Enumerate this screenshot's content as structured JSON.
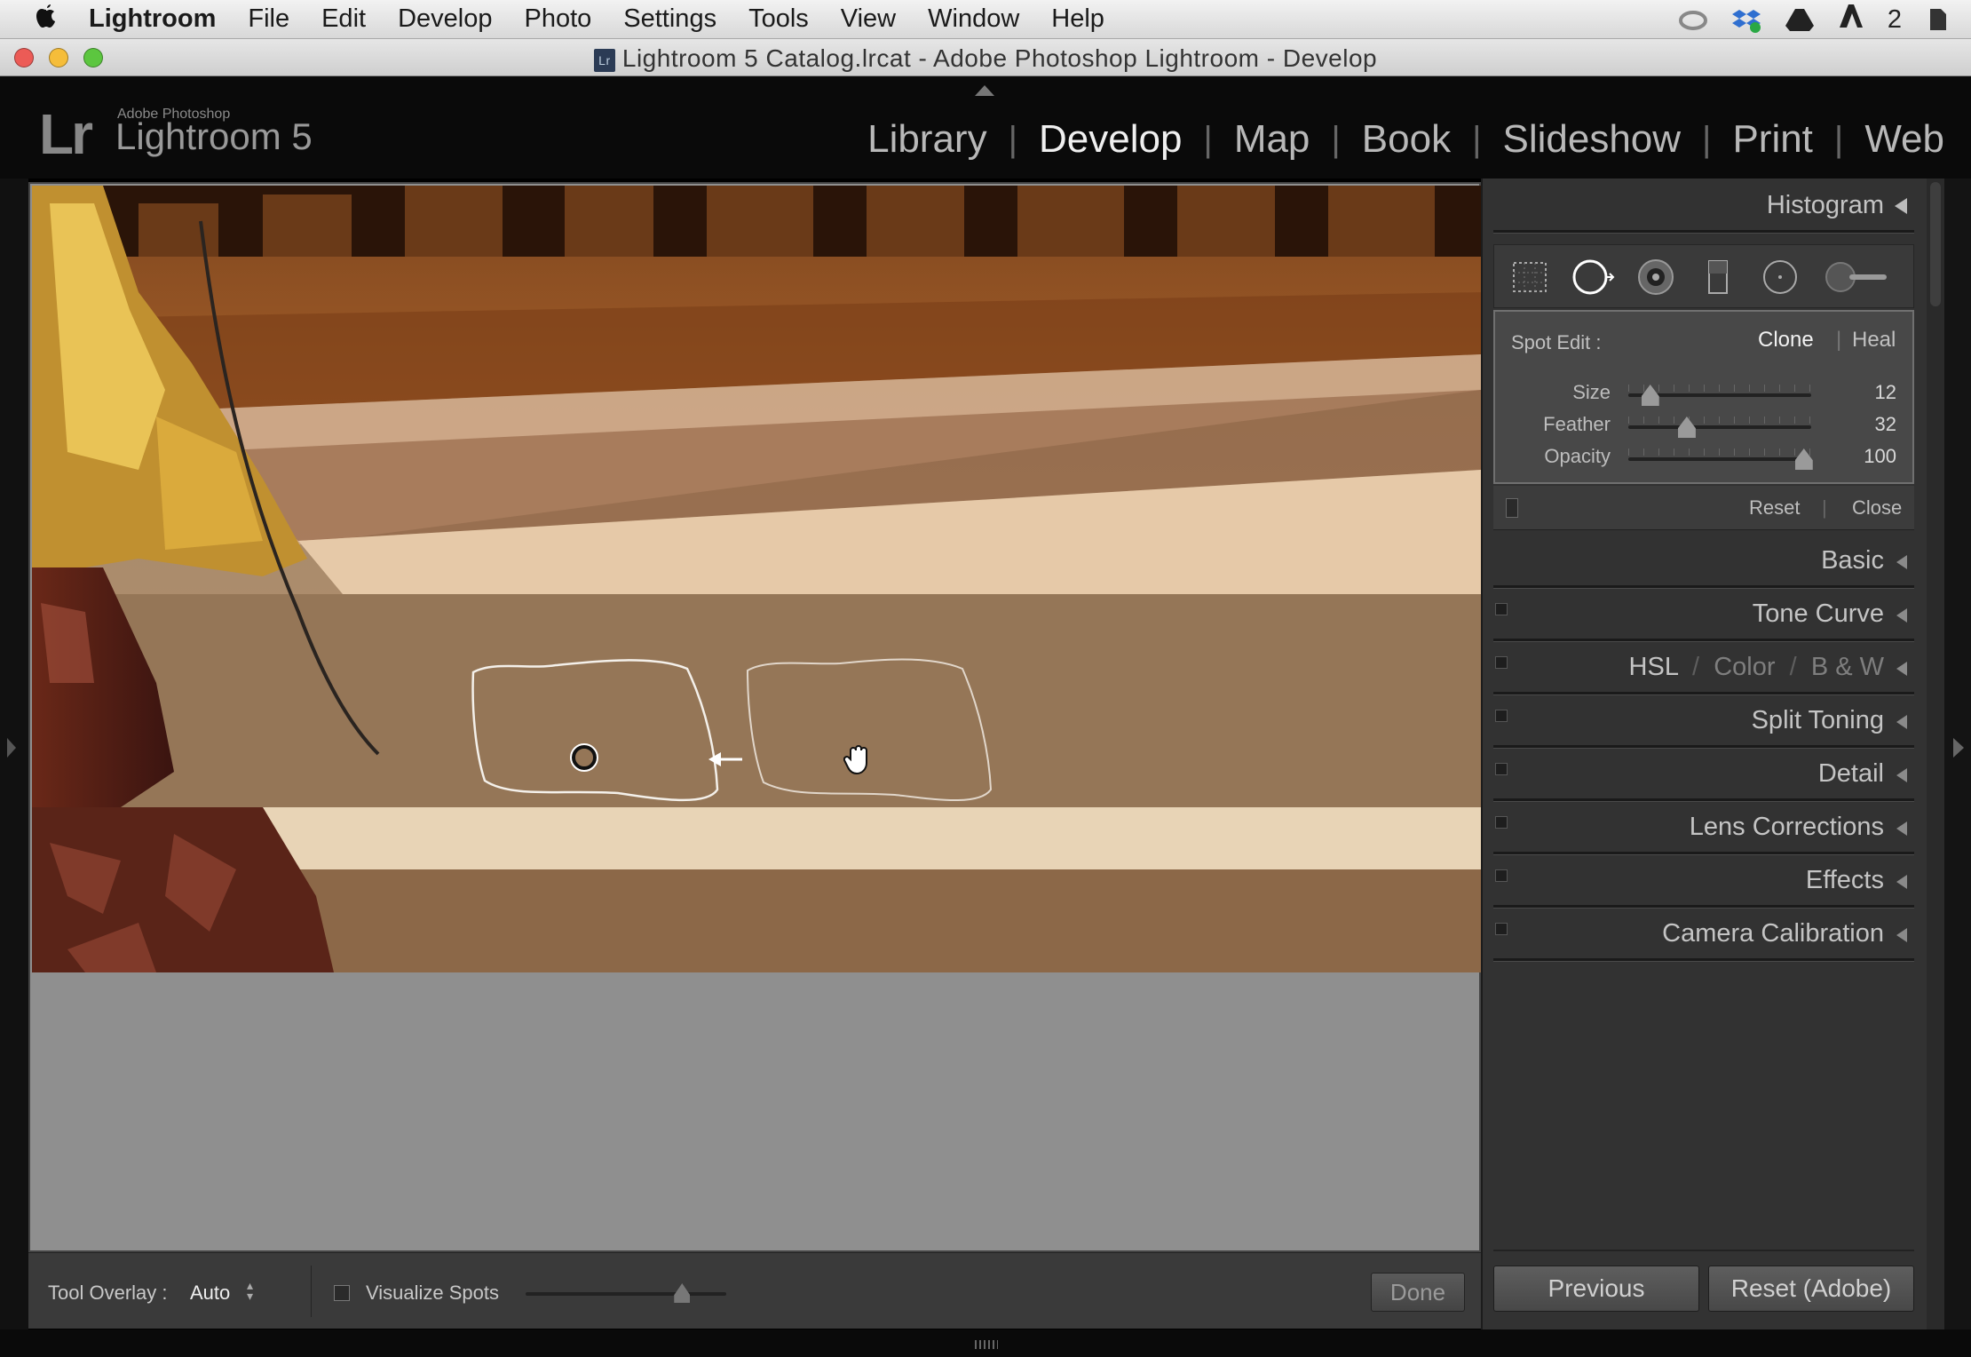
{
  "menubar": {
    "apple": "",
    "items": [
      "Lightroom",
      "File",
      "Edit",
      "Develop",
      "Photo",
      "Settings",
      "Tools",
      "View",
      "Window",
      "Help"
    ],
    "tray_count": "2"
  },
  "window": {
    "title": "Lightroom 5 Catalog.lrcat - Adobe Photoshop Lightroom - Develop",
    "icon_text": "Lr"
  },
  "identity": {
    "logo": "Lr",
    "small": "Adobe Photoshop",
    "big": "Lightroom 5"
  },
  "modules": {
    "items": [
      "Library",
      "Develop",
      "Map",
      "Book",
      "Slideshow",
      "Print",
      "Web"
    ],
    "active": "Develop"
  },
  "toolbar": {
    "overlay_label": "Tool Overlay :",
    "overlay_value": "Auto",
    "visualize_label": "Visualize Spots",
    "visualize_checked": false,
    "visualize_level": 0.78,
    "done_label": "Done"
  },
  "right_panel": {
    "histogram_title": "Histogram",
    "spot": {
      "label": "Spot Edit :",
      "clone": "Clone",
      "sep": "|",
      "heal": "Heal",
      "active_mode": "Clone",
      "sliders": [
        {
          "label": "Size",
          "value": "12",
          "level": 0.12
        },
        {
          "label": "Feather",
          "value": "32",
          "level": 0.32
        },
        {
          "label": "Opacity",
          "value": "100",
          "level": 0.96
        }
      ],
      "reset": "Reset",
      "close": "Close"
    },
    "panels": {
      "basic": "Basic",
      "tone": "Tone Curve",
      "hsl": "HSL",
      "color": "Color",
      "bw": "B & W",
      "split": "Split Toning",
      "detail": "Detail",
      "lens": "Lens Corrections",
      "effects": "Effects",
      "calibration": "Camera Calibration",
      "slash": "/"
    },
    "previous": "Previous",
    "reset_adobe": "Reset (Adobe)"
  },
  "colors": {
    "panel_bg": "#323232",
    "photo_bg": "#8f8f8f",
    "active_module": "#f0f0f0"
  }
}
